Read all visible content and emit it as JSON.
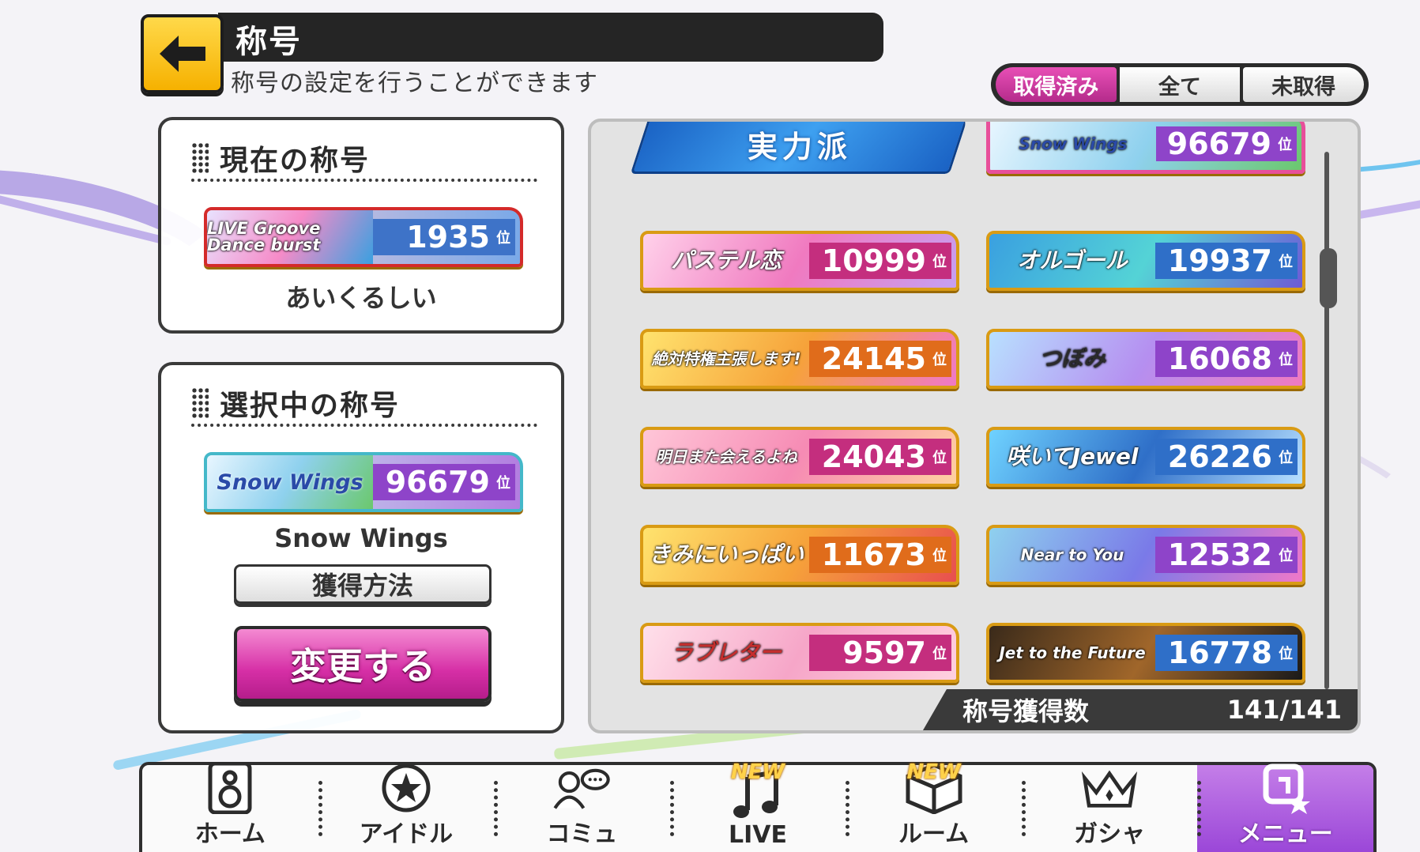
{
  "header": {
    "title": "称号",
    "subtitle": "称号の設定を行うことができます"
  },
  "filter_tabs": [
    {
      "label": "取得済み",
      "selected": true
    },
    {
      "label": "全て",
      "selected": false
    },
    {
      "label": "未取得",
      "selected": false
    }
  ],
  "current_title": {
    "heading": "現在の称号",
    "badge_text": "LIVE Groove Dance burst",
    "rank": "1935",
    "rank_unit": "位",
    "name": "あいくるしい"
  },
  "selected_title": {
    "heading": "選択中の称号",
    "badge_text": "Snow Wings",
    "rank": "96679",
    "rank_unit": "位",
    "name": "Snow Wings",
    "how_to_get_label": "獲得方法",
    "change_label": "変更する"
  },
  "title_list": [
    {
      "text": "実力派",
      "rank": "",
      "style": "blue"
    },
    {
      "text": "Snow Wings",
      "rank": "96679",
      "style": "snow",
      "selected": true
    },
    {
      "text": "パステル恋",
      "rank": "10999",
      "style": "pink"
    },
    {
      "text": "オルゴール",
      "rank": "19937",
      "style": "aqua"
    },
    {
      "text": "絶対特権主張します!",
      "rank": "24145",
      "style": "orange"
    },
    {
      "text": "つぼみ",
      "rank": "16068",
      "style": "purple"
    },
    {
      "text": "明日また会えるよね",
      "rank": "24043",
      "style": "peach"
    },
    {
      "text": "咲いてJewel",
      "rank": "26226",
      "style": "blue2"
    },
    {
      "text": "きみにいっぱい",
      "rank": "11673",
      "style": "sun"
    },
    {
      "text": "Near to You",
      "rank": "12532",
      "style": "sky"
    },
    {
      "text": "ラブレター",
      "rank": "9597",
      "style": "pink2"
    },
    {
      "text": "Jet to the Future",
      "rank": "16778",
      "style": "dark"
    }
  ],
  "rank_unit": "位",
  "count": {
    "label": "称号獲得数",
    "value": "141/141"
  },
  "nav": [
    {
      "label": "ホーム",
      "icon": "speaker-icon",
      "new": false
    },
    {
      "label": "アイドル",
      "icon": "star-badge-icon",
      "new": false
    },
    {
      "label": "コミュ",
      "icon": "chat-person-icon",
      "new": false
    },
    {
      "label": "LIVE",
      "icon": "music-note-icon",
      "new": true
    },
    {
      "label": "ルーム",
      "icon": "room-box-icon",
      "new": true
    },
    {
      "label": "ガシャ",
      "icon": "crown-icon",
      "new": false
    },
    {
      "label": "メニュー",
      "icon": "menu-icon",
      "new": false,
      "active": true
    }
  ],
  "new_tag": "NEW",
  "colors": {
    "accent_pink": "#d62fa6",
    "rank_purple": "#8e44c9",
    "gold_border": "#d99b14"
  }
}
